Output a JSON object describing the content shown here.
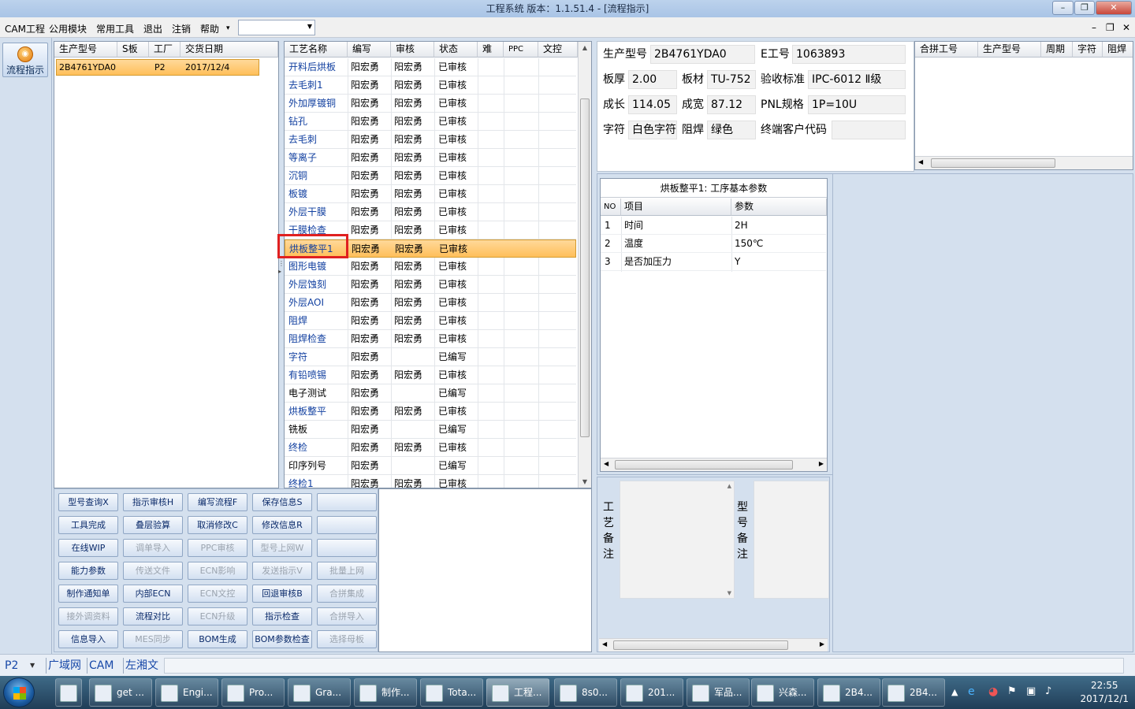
{
  "window": {
    "title": "工程系统    版本：1.1.51.4 - [流程指示]",
    "controls": {
      "minimize": "–",
      "restore": "❐",
      "close": "✕"
    }
  },
  "menubar": {
    "items": [
      "CAM工程",
      "公用模块",
      "常用工具",
      "退出",
      "注销",
      "帮助"
    ],
    "help_arrow": "▾",
    "combo_value": "",
    "mdi_controls": {
      "minimize": "–",
      "restore": "❐",
      "close": "✕"
    }
  },
  "leftbar": {
    "flow_button_label": "流程指示"
  },
  "orders": {
    "columns": [
      "生产型号",
      "S板",
      "工厂",
      "交货日期"
    ],
    "rows": [
      {
        "model": "2B4761YDA0",
        "s_board": "",
        "factory": "P2",
        "delivery": "2017/12/4"
      }
    ]
  },
  "process_table": {
    "columns": [
      "工艺名称",
      "编写",
      "审核",
      "状态",
      "难",
      "PPC",
      "文控"
    ],
    "rows": [
      {
        "name": "开料后烘板",
        "writer": "阳宏勇",
        "reviewer": "阳宏勇",
        "status": "已审核"
      },
      {
        "name": "去毛刺1",
        "writer": "阳宏勇",
        "reviewer": "阳宏勇",
        "status": "已审核"
      },
      {
        "name": "外加厚镀铜",
        "writer": "阳宏勇",
        "reviewer": "阳宏勇",
        "status": "已审核"
      },
      {
        "name": "钻孔",
        "writer": "阳宏勇",
        "reviewer": "阳宏勇",
        "status": "已审核"
      },
      {
        "name": "去毛刺",
        "writer": "阳宏勇",
        "reviewer": "阳宏勇",
        "status": "已审核"
      },
      {
        "name": "等离子",
        "writer": "阳宏勇",
        "reviewer": "阳宏勇",
        "status": "已审核"
      },
      {
        "name": "沉铜",
        "writer": "阳宏勇",
        "reviewer": "阳宏勇",
        "status": "已审核"
      },
      {
        "name": "板镀",
        "writer": "阳宏勇",
        "reviewer": "阳宏勇",
        "status": "已审核"
      },
      {
        "name": "外层干膜",
        "writer": "阳宏勇",
        "reviewer": "阳宏勇",
        "status": "已审核"
      },
      {
        "name": "干膜检查",
        "writer": "阳宏勇",
        "reviewer": "阳宏勇",
        "status": "已审核"
      },
      {
        "name": "烘板整平1",
        "writer": "阳宏勇",
        "reviewer": "阳宏勇",
        "status": "已审核"
      },
      {
        "name": "图形电镀",
        "writer": "阳宏勇",
        "reviewer": "阳宏勇",
        "status": "已审核"
      },
      {
        "name": "外层蚀刻",
        "writer": "阳宏勇",
        "reviewer": "阳宏勇",
        "status": "已审核"
      },
      {
        "name": "外层AOI",
        "writer": "阳宏勇",
        "reviewer": "阳宏勇",
        "status": "已审核"
      },
      {
        "name": "阻焊",
        "writer": "阳宏勇",
        "reviewer": "阳宏勇",
        "status": "已审核"
      },
      {
        "name": "阻焊检查",
        "writer": "阳宏勇",
        "reviewer": "阳宏勇",
        "status": "已审核"
      },
      {
        "name": "字符",
        "writer": "阳宏勇",
        "reviewer": "",
        "status": "已编写"
      },
      {
        "name": "有铅喷锡",
        "writer": "阳宏勇",
        "reviewer": "阳宏勇",
        "status": "已审核"
      },
      {
        "name": "电子测试",
        "writer": "阳宏勇",
        "reviewer": "",
        "status": "已编写"
      },
      {
        "name": "烘板整平",
        "writer": "阳宏勇",
        "reviewer": "阳宏勇",
        "status": "已审核"
      },
      {
        "name": "铣板",
        "writer": "阳宏勇",
        "reviewer": "",
        "status": "已编写"
      },
      {
        "name": "终检",
        "writer": "阳宏勇",
        "reviewer": "阳宏勇",
        "status": "已审核"
      },
      {
        "name": "印序列号",
        "writer": "阳宏勇",
        "reviewer": "",
        "status": "已编写"
      },
      {
        "name": "终检1",
        "writer": "阳宏勇",
        "reviewer": "阳宏勇",
        "status": "已审核"
      }
    ],
    "selected_name": "烘板整平1"
  },
  "actions": {
    "rows": [
      [
        "型号查询X",
        "指示审核H",
        "编写流程F",
        "保存信息S",
        ""
      ],
      [
        "工具完成",
        "叠层验算",
        "取消修改C",
        "修改信息R",
        ""
      ],
      [
        "在线WIP",
        "调单导入",
        "PPC审核",
        "型号上网W",
        ""
      ],
      [
        "能力参数",
        "传送文件",
        "ECN影响",
        "发送指示V",
        "批量上网"
      ],
      [
        "制作通知单",
        "内部ECN",
        "ECN文控",
        "回退审核B",
        "合拼集成"
      ],
      [
        "接外调资料",
        "流程对比",
        "ECN升级",
        "指示检查",
        "合拼导入"
      ],
      [
        "信息导入",
        "MES同步",
        "BOM生成",
        "BOM参数检查",
        "选择母板"
      ]
    ]
  },
  "info": {
    "model_label": "生产型号",
    "model": "2B4761YDA0",
    "eno_label": "E工号",
    "eno": "1063893",
    "thickness_label": "板厚",
    "thickness": "2.00",
    "material_label": "板材",
    "material": "TU-752",
    "standard_label": "验收标准",
    "standard": "IPC-6012 Ⅱ级",
    "length_label": "成长",
    "length": "114.05",
    "width_label": "成宽",
    "width": "87.12",
    "pnl_label": "PNL规格",
    "pnl": "1P=10U",
    "char_label": "字符",
    "char": "白色字符",
    "mask_label": "阻焊",
    "mask": "绿色",
    "customer_label": "终端客户代码",
    "customer": ""
  },
  "merge_table": {
    "columns": [
      "合拼工号",
      "生产型号",
      "周期",
      "字符",
      "阻焊"
    ]
  },
  "params": {
    "title": "烘板整平1: 工序基本参数",
    "columns": [
      "NO",
      "项目",
      "参数"
    ],
    "rows": [
      {
        "no": "1",
        "item": "时间",
        "value": "2H"
      },
      {
        "no": "2",
        "item": "温度",
        "value": "150℃"
      },
      {
        "no": "3",
        "item": "是否加压力",
        "value": "Y"
      }
    ]
  },
  "notes": {
    "process_label": "工艺备注",
    "model_label": "型号备注",
    "process_text": "",
    "model_text": ""
  },
  "statusbar": {
    "factory": "P2",
    "items": [
      "广域网",
      "CAM",
      "左湘文"
    ]
  },
  "taskbar": {
    "buttons": [
      "get ...",
      "Engi...",
      "Pro...",
      "Gra...",
      "制作...",
      "Tota...",
      "工程...",
      "8s0...",
      "201...",
      "军品...",
      "兴森...",
      "2B4...",
      "2B4..."
    ],
    "time": "22:55",
    "date": "2017/12/1"
  },
  "colors": {
    "selection": "#ffc870",
    "link_text": "#1240a0",
    "highlight_box": "#e02020",
    "chrome": "#d4e0ee"
  }
}
